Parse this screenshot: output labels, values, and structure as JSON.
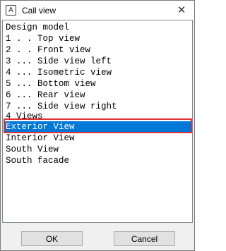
{
  "window": {
    "title": "Call view",
    "app_icon_glyph": "A",
    "close_glyph": "✕"
  },
  "list": {
    "items": [
      "Design model",
      "1 . . Top view",
      "2 . . Front view",
      "3 ... Side view left",
      "4 ... Isometric view",
      "5 ... Bottom view",
      "6 ... Rear view",
      "7 ... Side view right",
      "4 Views",
      "Exterior View",
      "Interior View",
      "South View",
      "South facade"
    ],
    "selected_index": 9
  },
  "buttons": {
    "ok": "OK",
    "cancel": "Cancel"
  },
  "colors": {
    "selection": "#0078d7",
    "highlight_border": "#e03030"
  }
}
